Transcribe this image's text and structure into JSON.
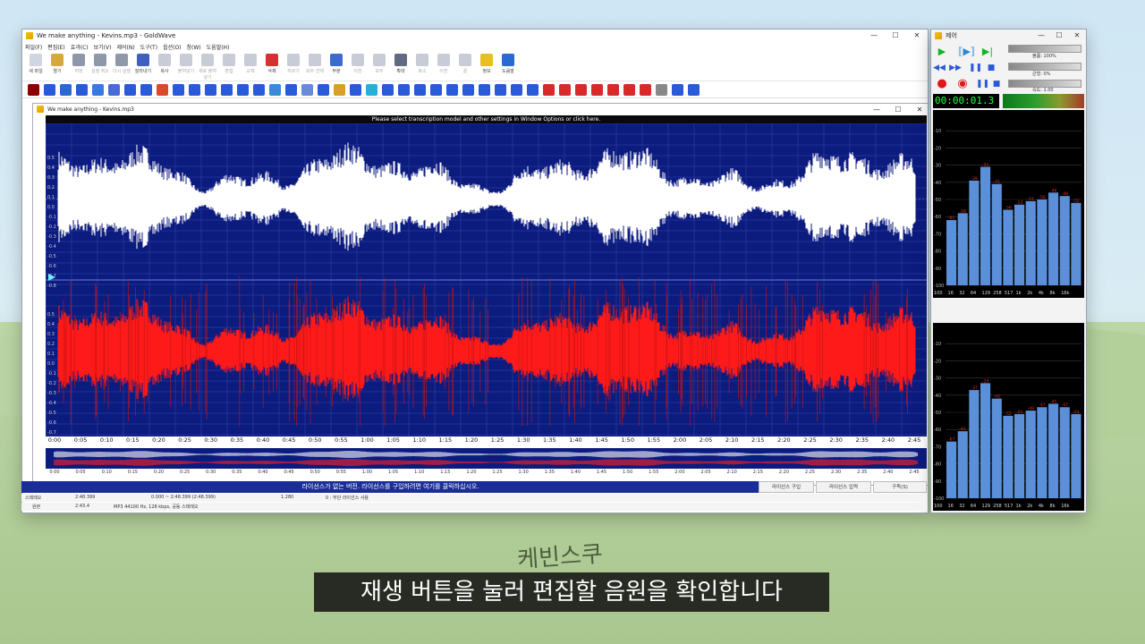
{
  "main_window": {
    "title": "We make anything - Kevins.mp3 - GoldWave",
    "controls": {
      "minimize": "—",
      "maximize": "☐",
      "close": "✕"
    },
    "menu": [
      "파일(F)",
      "편집(E)",
      "효과(C)",
      "보기(V)",
      "제어(N)",
      "도구(T)",
      "옵션(O)",
      "창(W)",
      "도움말(H)"
    ],
    "toolbar": [
      {
        "label": "새 파일",
        "icon": "new-file-icon",
        "color": "#cfd6e0",
        "enabled": true
      },
      {
        "label": "열기",
        "icon": "open-folder-icon",
        "color": "#d7a93a",
        "enabled": true
      },
      {
        "label": "저장",
        "icon": "save-icon",
        "color": "#8f98a8",
        "enabled": false
      },
      {
        "label": "실행 취소",
        "icon": "undo-icon",
        "color": "#8f98a8",
        "enabled": false
      },
      {
        "label": "다시 실행",
        "icon": "redo-icon",
        "color": "#8f98a8",
        "enabled": false
      },
      {
        "label": "잘라내기",
        "icon": "cut-icon",
        "color": "#4060c0",
        "enabled": true
      },
      {
        "label": "복사",
        "icon": "copy-icon",
        "color": "#c7ccd6",
        "enabled": true
      },
      {
        "label": "붙여넣기",
        "icon": "paste-icon",
        "color": "#c7ccd6",
        "enabled": false
      },
      {
        "label": "새로 붙여넣기",
        "icon": "paste-new-icon",
        "color": "#c7ccd6",
        "enabled": false
      },
      {
        "label": "혼합",
        "icon": "mix-icon",
        "color": "#c7ccd6",
        "enabled": false
      },
      {
        "label": "교체",
        "icon": "replace-icon",
        "color": "#c7ccd6",
        "enabled": false
      },
      {
        "label": "삭제",
        "icon": "delete-icon",
        "color": "#d83030",
        "enabled": true
      },
      {
        "label": "자르기",
        "icon": "trim-icon",
        "color": "#c7ccd6",
        "enabled": false
      },
      {
        "label": "모두 선택",
        "icon": "select-all-icon",
        "color": "#c7ccd6",
        "enabled": false
      },
      {
        "label": "부분",
        "icon": "select-view-icon",
        "color": "#3a6ad0",
        "enabled": true
      },
      {
        "label": "이전",
        "icon": "previous-selection-icon",
        "color": "#c7ccd6",
        "enabled": false
      },
      {
        "label": "모두",
        "icon": "zoom-all-icon",
        "color": "#c7ccd6",
        "enabled": false
      },
      {
        "label": "확대",
        "icon": "zoom-in-icon",
        "color": "#606a80",
        "enabled": true
      },
      {
        "label": "축소",
        "icon": "zoom-out-icon",
        "color": "#c7ccd6",
        "enabled": false
      },
      {
        "label": "이전",
        "icon": "zoom-previous-icon",
        "color": "#c7ccd6",
        "enabled": false
      },
      {
        "label": "끝",
        "icon": "zoom-end-icon",
        "color": "#c7ccd6",
        "enabled": false
      },
      {
        "label": "정보",
        "icon": "info-icon",
        "color": "#e5c020",
        "enabled": true
      },
      {
        "label": "도움말",
        "icon": "help-icon",
        "color": "#2a6ad0",
        "enabled": true
      }
    ],
    "effects_toolbar_count": 42
  },
  "document_window": {
    "title": "We make anything - Kevins.mp3",
    "notice": "Please select transcription model and other settings in Window Options or click here.",
    "timeline_ticks": [
      "0:00",
      "0:05",
      "0:10",
      "0:15",
      "0:20",
      "0:25",
      "0:30",
      "0:35",
      "0:40",
      "0:45",
      "0:50",
      "0:55",
      "1:00",
      "1:05",
      "1:10",
      "1:15",
      "1:20",
      "1:25",
      "1:30",
      "1:35",
      "1:40",
      "1:45",
      "1:50",
      "1:55",
      "2:00",
      "2:05",
      "2:10",
      "2:15",
      "2:20",
      "2:25",
      "2:30",
      "2:35",
      "2:40",
      "2:45"
    ],
    "channel_labels": [
      "0.5",
      "0.4",
      "0.3",
      "0.2",
      "0.1",
      "0.0",
      "-0.1",
      "-0.2",
      "-0.3",
      "-0.4",
      "-0.5",
      "-0.6",
      "-0.7",
      "-0.8"
    ],
    "left_channel_color": "#ffffff",
    "right_channel_color": "#ff1a1a",
    "wave_background": "#0c1b7e"
  },
  "license_bar": {
    "message": "라이선스가 없는 버전. 라이선스를 구입하려면 여기를 클릭하십시오.",
    "buy": "라이선스 구입",
    "enter": "라이선스 입력",
    "subscribe": "구독(S)"
  },
  "status": {
    "stereo": "스테레오",
    "length": "2:48.399",
    "selection": "0.000 ~ 2:48.399 (2:48.399)",
    "zoom": "1.280",
    "license_state": "0 : 무단 라이선스 사용",
    "original": "원본",
    "original_length": "2:43.4",
    "format": "MP3 44100 Hz, 128 kbps, 공동 스테레오"
  },
  "control_window": {
    "title": "제어",
    "volume_label": "볼륨: 100%",
    "balance_label": "균형: 0%",
    "speed_label": "속도: 1.00",
    "time": "00:00:01.3",
    "spectrum_freqs": [
      "100",
      "16",
      "32",
      "64",
      "129",
      "258",
      "517",
      "1k",
      "2k",
      "4k",
      "8k",
      "16k"
    ],
    "db_ticks": [
      "-10",
      "-20",
      "-30",
      "-40",
      "-50",
      "-60",
      "-70",
      "-80",
      "-90",
      "-100"
    ],
    "top_spectrum_values": [
      -62,
      -58,
      -39,
      -31,
      -41,
      -56,
      -53,
      -51,
      -50,
      -46,
      -48,
      -52
    ],
    "bottom_spectrum_values": [
      -67,
      -61,
      -37,
      -33,
      -42,
      -52,
      -51,
      -49,
      -47,
      -45,
      -47,
      -51
    ]
  },
  "subtitle": "재생 버튼을 눌러 편집할 음원을 확인합니다",
  "channel_logo": "케빈스쿠"
}
